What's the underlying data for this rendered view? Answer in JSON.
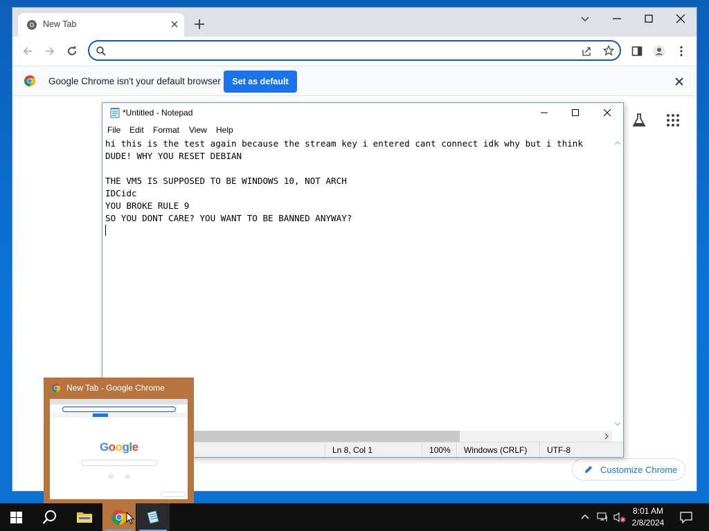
{
  "browser": {
    "tab": {
      "title": "New Tab"
    },
    "omnibox": {
      "placeholder": "",
      "value": ""
    },
    "infobar": {
      "message": "Google Chrome isn't your default browser",
      "button": "Set as default"
    },
    "customize": {
      "label": "Customize Chrome"
    }
  },
  "notepad": {
    "title": "*Untitled - Notepad",
    "menu": [
      "File",
      "Edit",
      "Format",
      "View",
      "Help"
    ],
    "lines": [
      "hi this is the test again because the stream key i entered cant connect idk why but i think",
      "DUDE! WHY YOU RESET DEBIAN",
      "",
      "THE VM5 IS SUPPOSED TO BE WINDOWS 10, NOT ARCH",
      "IDCidc",
      "YOU BROKE RULE 9",
      "SO YOU DONT CARE? YOU WANT TO BE BANNED ANYWAY?"
    ],
    "status": {
      "position": "Ln 8, Col 1",
      "zoom": "100%",
      "line_ending": "Windows (CRLF)",
      "encoding": "UTF-8"
    }
  },
  "thumbnail": {
    "title": "New Tab - Google Chrome",
    "google_text": "Google"
  },
  "taskbar": {
    "time": "8:01 AM",
    "date": "2/8/2024"
  },
  "colors": {
    "accent": "#1a73e8",
    "omnibox_border": "#0b57d0",
    "taskbar_active": "#b8743e",
    "desktop": "#0a74d6"
  }
}
